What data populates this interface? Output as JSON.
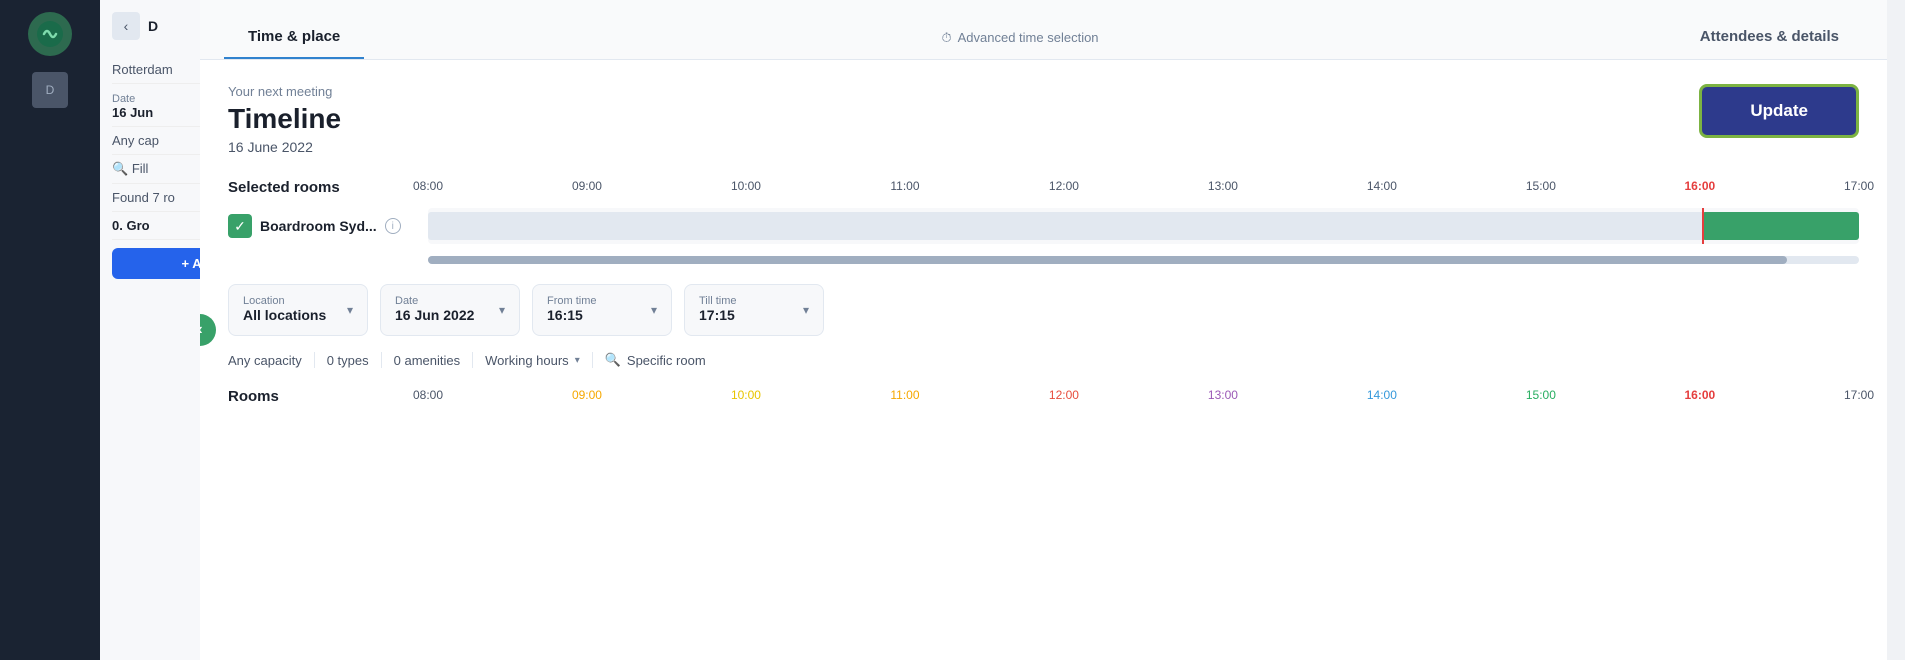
{
  "sidebar": {
    "logo_initial": "D",
    "nav_items": []
  },
  "background": {
    "left_panel": {
      "nav_back": "‹",
      "section": "D",
      "date_label": "Date",
      "date_value": "16 Jun",
      "capacity_label": "Any cap",
      "filter_label": "Fill",
      "found_label": "Found 7 ro",
      "ground_label": "0. Gro",
      "location_label": "Rotterdam"
    }
  },
  "modal": {
    "tabs": [
      {
        "label": "Time & place",
        "active": true
      },
      {
        "label": "Attendees & details",
        "active": false
      }
    ],
    "advanced_time_label": "Advanced time selection",
    "meeting_label": "Your next meeting",
    "title": "Timeline",
    "date": "16 June 2022",
    "update_button": "Update",
    "selected_rooms_label": "Selected rooms",
    "timeline_hours": [
      "08:00",
      "09:00",
      "10:00",
      "11:00",
      "12:00",
      "13:00",
      "14:00",
      "15:00",
      "16:00",
      "17:00"
    ],
    "rooms": [
      {
        "name": "Boardroom Syd...",
        "checked": true,
        "info": true,
        "booked_start_pct": 90,
        "booked_width_pct": 10
      }
    ],
    "filters": {
      "location_label": "Location",
      "location_value": "All locations",
      "date_label": "Date",
      "date_value": "16 Jun 2022",
      "from_time_label": "From time",
      "from_time_value": "16:15",
      "till_time_label": "Till time",
      "till_time_value": "17:15"
    },
    "chips": {
      "capacity": "Any capacity",
      "types": "0 types",
      "amenities": "0 amenities",
      "working_hours": "Working hours",
      "specific_room": "Specific room"
    },
    "rooms_section_label": "Rooms",
    "rooms_timeline_hours": [
      "08:00",
      "09:00",
      "10:00",
      "11:00",
      "12:00",
      "13:00",
      "14:00",
      "15:00",
      "16:00",
      "17:00"
    ],
    "current_time_pct": 89.6
  }
}
